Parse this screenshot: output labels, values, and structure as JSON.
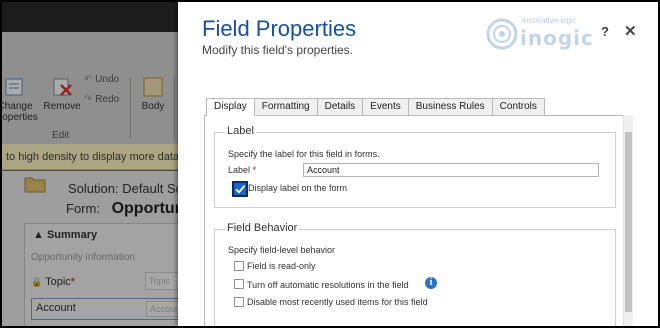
{
  "background": {
    "ribbon": {
      "change_properties_label": "Change Properties",
      "remove_label": "Remove",
      "undo_label": "Undo",
      "redo_label": "Redo",
      "edit_group_label": "Edit",
      "body_label": "Body"
    },
    "notice": "to high density to display more data. Use",
    "solution_line": "Solution: Default Solu",
    "form_label": "Form:",
    "form_name": "Opportunity",
    "section_summary": "Summary",
    "section_opportunity_info": "Opportunity information",
    "topic_label": "Topic",
    "topic_field_placeholder": "Topic",
    "account_label": "Account",
    "account_field_placeholder": "Account"
  },
  "dialog": {
    "title": "Field Properties",
    "subtitle": "Modify this field's properties.",
    "logo_tagline": "innovative logic",
    "logo_word": "inogic",
    "help_label": "?",
    "close_label": "✕",
    "tabs": [
      {
        "label": "Display",
        "active": true
      },
      {
        "label": "Formatting",
        "active": false
      },
      {
        "label": "Details",
        "active": false
      },
      {
        "label": "Events",
        "active": false
      },
      {
        "label": "Business Rules",
        "active": false
      },
      {
        "label": "Controls",
        "active": false
      }
    ],
    "label_section": {
      "title": "Label",
      "description": "Specify the label for this field in forms.",
      "field_label": "Label",
      "required_marker": "*",
      "value": "Account",
      "display_label_checkbox": "Display label on the form",
      "display_label_checked": true
    },
    "behavior_section": {
      "title": "Field Behavior",
      "description": "Specify field-level behavior",
      "options": [
        {
          "label": "Field is read-only",
          "checked": false
        },
        {
          "label": "Turn off automatic resolutions in the field",
          "checked": false
        },
        {
          "label": "Disable most recently used items for this field",
          "checked": false
        }
      ],
      "info_icon": "info-icon"
    }
  },
  "colors": {
    "title_blue": "#1a4fa0",
    "checkbox_blue": "#1b64c8",
    "required_red": "#cc0000",
    "notice_yellow": "#fff6c4"
  }
}
